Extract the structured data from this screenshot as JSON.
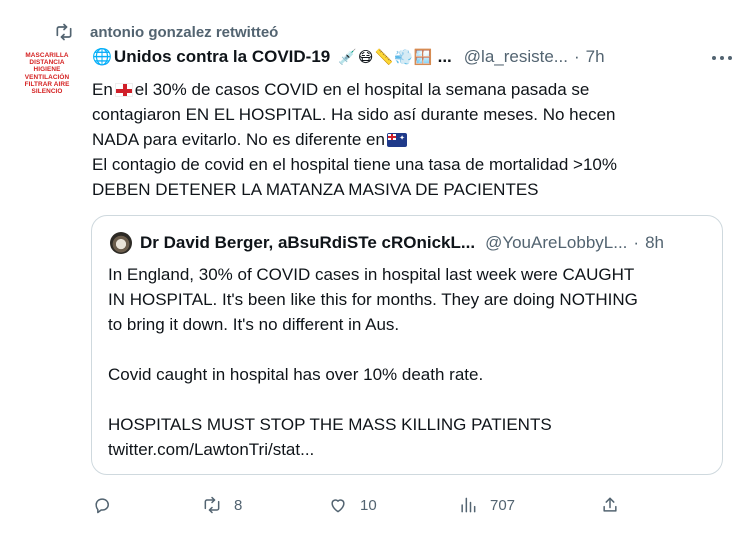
{
  "retweet": {
    "label": "antonio gonzalez retwitteó"
  },
  "avatar": {
    "lines": [
      "MASCARILLA",
      "DISTANCIA",
      "HIGIENE",
      "VENTILACIÓN",
      "FILTRAR AIRE",
      "SILENCIO"
    ],
    "color": "#d42020"
  },
  "tweet": {
    "display_name": "Unidos contra la COVID-19",
    "name_emojis": "💉😷📏💨🪟",
    "ellipsis": "...",
    "handle": "@la_resiste...",
    "separator": "·",
    "time": "7h",
    "body": {
      "line1_before": "En",
      "line1_after": "el 30% de casos COVID en el hospital la semana pasada se",
      "line2": "contagiaron EN EL HOSPITAL. Ha sido así durante meses. No hecen",
      "line3_before": "NADA para evitarlo. No es diferente en",
      "line4": "El contagio de covid en el hospital tiene una tasa de mortalidad >10%",
      "line5": "DEBEN DETENER LA MATANZA MASIVA DE PACIENTES"
    }
  },
  "quote": {
    "name": "Dr David Berger, aBsuRdiSTe cRОnickL...",
    "handle": "@YouAreLobbyL...",
    "separator": "·",
    "time": "8h",
    "lines": [
      "In England, 30% of COVID cases in hospital last week were CAUGHT",
      "IN HOSPITAL. It's been like this for months. They are doing NOTHING",
      "to bring it down. It's no different in Aus."
    ],
    "line4": "Covid caught in hospital has over 10% death rate.",
    "line5": "HOSPITALS MUST STOP THE MASS KILLING PATIENTS",
    "link": "twitter.com/LawtonTri/stat..."
  },
  "actions": {
    "reply_count": "",
    "retweet_count": "8",
    "like_count": "10",
    "views_count": "707"
  },
  "colors": {
    "text": "#0f1419",
    "secondary": "#536471",
    "border": "#cfd9de"
  }
}
